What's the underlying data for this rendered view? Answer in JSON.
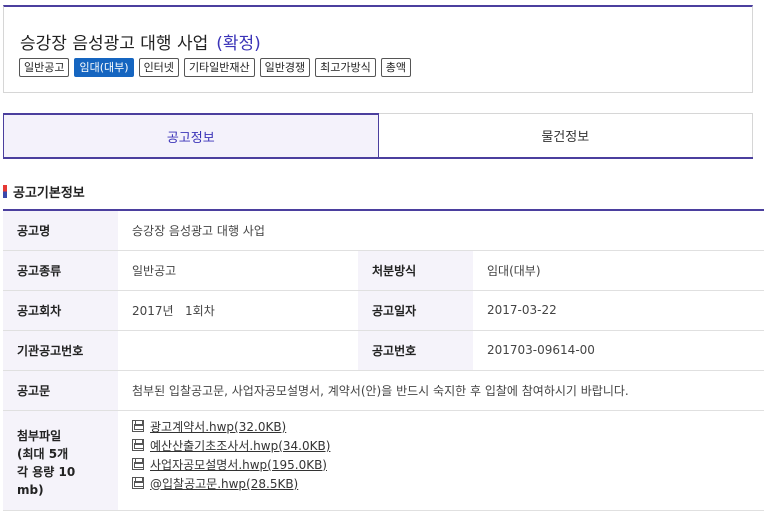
{
  "header": {
    "title": "승강장 음성광고 대행 사업",
    "status": "(확정)",
    "tags": [
      {
        "label": "일반공고",
        "active": false
      },
      {
        "label": "임대(대부)",
        "active": true
      },
      {
        "label": "인터넷",
        "active": false
      },
      {
        "label": "기타일반재산",
        "active": false
      },
      {
        "label": "일반경쟁",
        "active": false
      },
      {
        "label": "최고가방식",
        "active": false
      },
      {
        "label": "총액",
        "active": false
      }
    ]
  },
  "tabs": [
    {
      "label": "공고정보",
      "active": true
    },
    {
      "label": "물건정보",
      "active": false
    }
  ],
  "section": {
    "title": "공고기본정보"
  },
  "info": {
    "name_label": "공고명",
    "name_value": "승강장 음성광고 대행 사업",
    "type_label": "공고종류",
    "type_value": "일반공고",
    "disposal_label": "처분방식",
    "disposal_value": "임대(대부)",
    "round_label": "공고회차",
    "round_value": "2017년   1회차",
    "date_label": "공고일자",
    "date_value": "2017-03-22",
    "agency_no_label": "기관공고번호",
    "agency_no_value": "",
    "notice_no_label": "공고번호",
    "notice_no_value": "201703-09614-00",
    "text_label": "공고문",
    "text_value": "첨부된 입찰공고문, 사업자공모설명서, 계약서(안)을 반드시 숙지한 후 입찰에 참여하시기 바랍니다.",
    "files_label_1": "첨부파일",
    "files_label_2": "(최대 5개",
    "files_label_3": "각 용량 10 mb)",
    "files": [
      "광고계약서.hwp(32.0KB)",
      "예산산출기초조사서.hwp(34.0KB)",
      "사업자공모설명서.hwp(195.0KB)",
      "@입찰공고문.hwp(28.5KB)"
    ]
  },
  "colors": {
    "accent": "#4b3f9e",
    "active_tag": "#1565c0",
    "status": "#3b34b8"
  }
}
